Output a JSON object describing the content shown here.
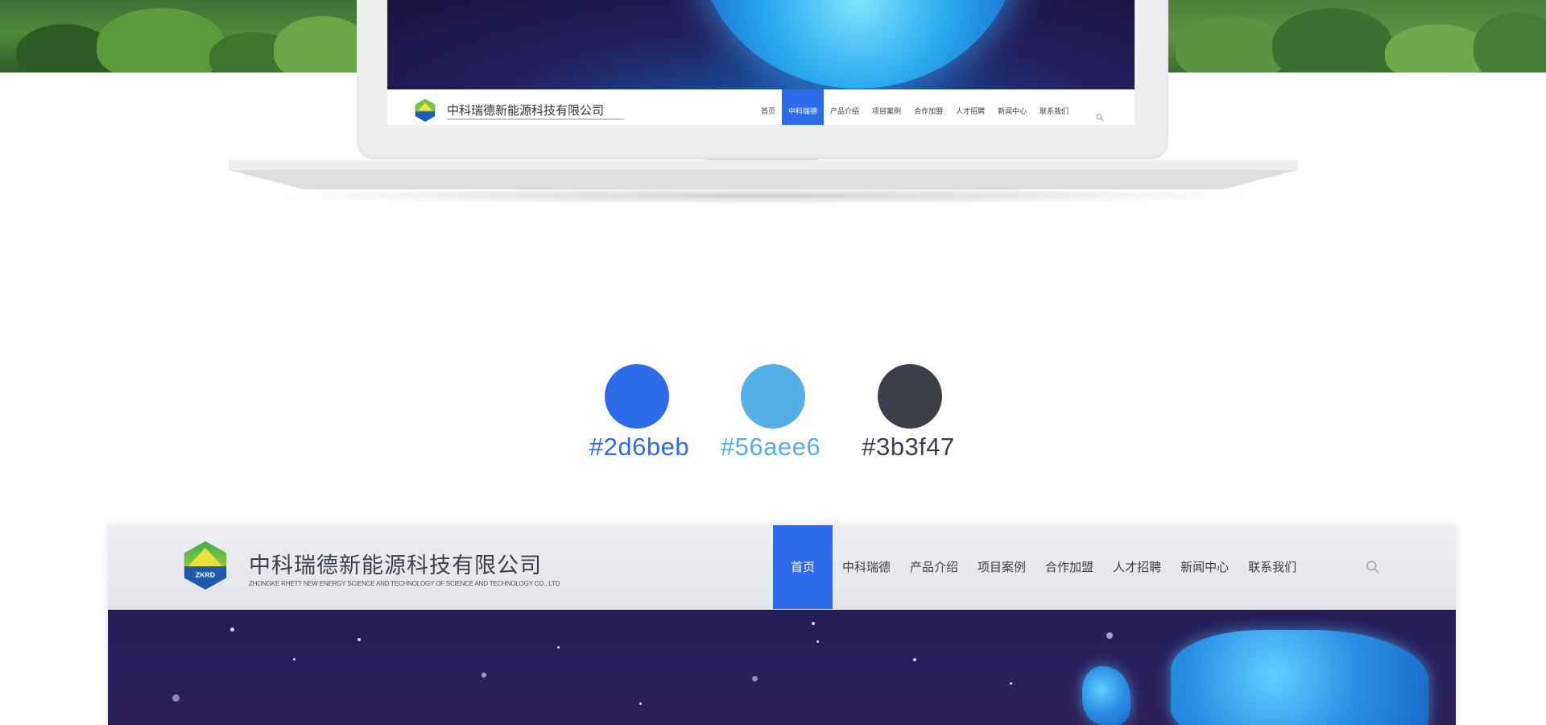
{
  "laptop_site": {
    "company_name": "中科瑞德新能源科技有限公司",
    "menu": [
      "首页",
      "中科瑞德",
      "产品介绍",
      "项目案例",
      "合作加盟",
      "人才招聘",
      "新闻中心",
      "联系我们"
    ],
    "active_index": 1
  },
  "palette": [
    {
      "hex": "#2d6beb",
      "label": "#2d6beb"
    },
    {
      "hex": "#56aee6",
      "label": "#56aee6"
    },
    {
      "hex": "#3b3f47",
      "label": "#3b3f47"
    }
  ],
  "site": {
    "logo_text": "ZKRD",
    "company_name": "中科瑞德新能源科技有限公司",
    "company_subtitle": "ZHONGKE RHETT NEW ENERGY SCIENCE AND TECHNOLOGY OF SCIENCE AND TECHNOLOGY CO., LTD",
    "menu": [
      "首页",
      "中科瑞德",
      "产品介绍",
      "项目案例",
      "合作加盟",
      "人才招聘",
      "新闻中心",
      "联系我们"
    ],
    "active_index": 0,
    "accent_color": "#2d6beb"
  },
  "icons": {
    "logo": "zkrd-hexagon-logo-icon",
    "search": "search-icon"
  }
}
